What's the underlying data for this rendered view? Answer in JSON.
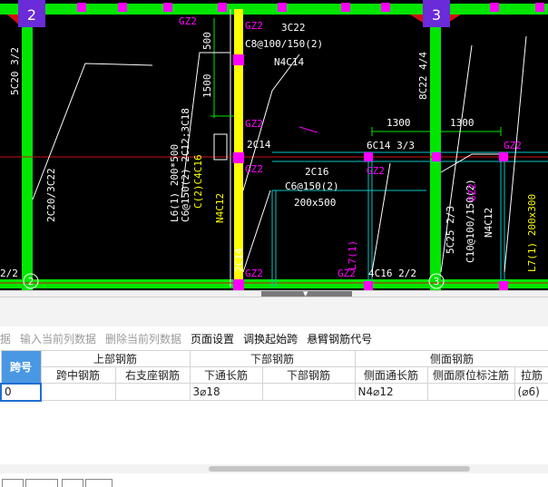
{
  "drawing": {
    "axis_markers": [
      "2",
      "3"
    ],
    "axis_labels_bottom": [
      "2",
      "3"
    ],
    "texts": {
      "gz2": "GZ2",
      "beam_3c22": "3C22",
      "stirrup_c8": "C8@100/150(2)",
      "n4c14": "N4C14",
      "d500": "500",
      "d1500": "1500",
      "left_5c20": "5C20 3/2",
      "right_8c22": "8C22 4/4",
      "dim_1300": "1300",
      "top_6c14": "6C14 3/3",
      "mid_2c14": "2C14",
      "mid_2c16": "2C16",
      "mid_c6": "C6@150(2)",
      "mid_size": "200x500",
      "left_2c20": "2C20/3C22",
      "left_22": "2/2",
      "bottom_2c14": "2C14",
      "bottom_4c16": "4C16 2/2",
      "r_5c25": "5C25 2/3",
      "r_c10": "C10@100/150(2)",
      "r_n4c12": "N4C12",
      "l7": "L7(1)",
      "l6_lines": [
        "L6(1) 200*500",
        "C6@150(2) 2C12;3C18",
        "C(2)C4C16",
        "N4C12"
      ],
      "l7b": "L7(1) 200x300"
    }
  },
  "toolbar": {
    "items": [
      {
        "label": "据",
        "enabled": false
      },
      {
        "label": "输入当前列数据",
        "enabled": false
      },
      {
        "label": "删除当前列数据",
        "enabled": false
      },
      {
        "label": "页面设置",
        "enabled": true
      },
      {
        "label": "调换起始跨",
        "enabled": true
      },
      {
        "label": "悬臂钢筋代号",
        "enabled": true
      }
    ]
  },
  "table": {
    "span_header": "跨号",
    "group_headers": {
      "upper": "上部钢筋",
      "lower": "下部钢筋",
      "side": "侧面钢筋"
    },
    "columns": {
      "mid_span": "跨中钢筋",
      "right_support": "右支座钢筋",
      "lower_through": "下通长筋",
      "lower_bar": "下部钢筋",
      "side_through": "侧面通长筋",
      "side_original": "侧面原位标注筋",
      "tie_bar": "拉筋"
    },
    "row": {
      "span": "0",
      "mid_span": "",
      "right_support": "",
      "lower_through": "3⌀18",
      "lower_bar": "",
      "side_through": "N4⌀12",
      "side_original": "",
      "tie_bar": "(⌀6)"
    }
  },
  "colors": {
    "canvas_bg": "#000000",
    "beam_green": "#00e600",
    "column_yellow": "#ffff00",
    "marker_magenta": "#ff00ff",
    "axis_purple": "#6a2bd8",
    "header_blue": "#4a98e3"
  }
}
